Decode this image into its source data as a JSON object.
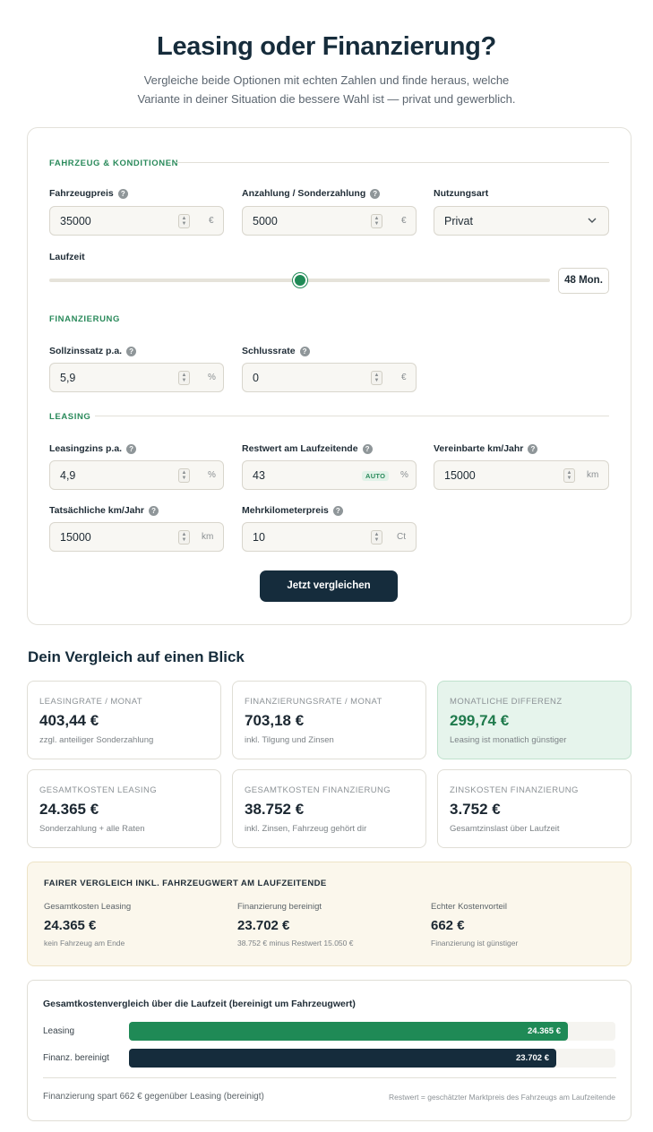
{
  "header": {
    "title": "Leasing oder Finanzierung?",
    "subtitle": "Vergleiche beide Optionen mit echten Zahlen und finde heraus, welche Variante in deiner Situation die bessere Wahl ist — privat und gewerblich."
  },
  "form": {
    "section_vehicle": "Fahrzeug & Konditionen",
    "section_financing": "Finanzierung",
    "section_leasing": "Leasing",
    "vehicle_price": {
      "label": "Fahrzeugpreis",
      "value": "35000",
      "unit": "€"
    },
    "down_payment": {
      "label": "Anzahlung / Sonderzahlung",
      "value": "5000",
      "unit": "€"
    },
    "usage": {
      "label": "Nutzungsart",
      "value": "Privat"
    },
    "term": {
      "label": "Laufzeit",
      "value": "48 Mon.",
      "slider_fraction": 0.5
    },
    "interest_rate": {
      "label": "Sollzinssatz p.a.",
      "value": "5,9",
      "unit": "%"
    },
    "final_rate": {
      "label": "Schlussrate",
      "value": "0",
      "unit": "€"
    },
    "leasing_rate": {
      "label": "Leasingzins p.a.",
      "value": "4,9",
      "unit": "%"
    },
    "residual": {
      "label": "Restwert am Laufzeitende",
      "value": "43",
      "badge": "AUTO",
      "unit": "%"
    },
    "agreed_km": {
      "label": "Vereinbarte km/Jahr",
      "value": "15000",
      "unit": "km"
    },
    "actual_km": {
      "label": "Tatsächliche km/Jahr",
      "value": "15000",
      "unit": "km"
    },
    "extra_km_price": {
      "label": "Mehrkilometerpreis",
      "value": "10",
      "unit": "Ct"
    },
    "help_glyph": "?",
    "submit": "Jetzt vergleichen"
  },
  "results": {
    "heading": "Dein Vergleich auf einen Blick",
    "cards": [
      {
        "key": "Leasingrate / Monat",
        "value": "403,44 €",
        "sub": "zzgl. anteiliger Sonderzahlung"
      },
      {
        "key": "Finanzierungsrate / Monat",
        "value": "703,18 €",
        "sub": "inkl. Tilgung und Zinsen"
      },
      {
        "key": "Monatliche Differenz",
        "value": "299,74 €",
        "sub": "Leasing ist monatlich günstiger"
      },
      {
        "key": "Gesamtkosten Leasing",
        "value": "24.365 €",
        "sub": "Sonderzahlung + alle Raten"
      },
      {
        "key": "Gesamtkosten Finanzierung",
        "value": "38.752 €",
        "sub": "inkl. Zinsen, Fahrzeug gehört dir"
      },
      {
        "key": "Zinskosten Finanzierung",
        "value": "3.752 €",
        "sub": "Gesamtzinslast über Laufzeit"
      }
    ],
    "fair": {
      "title": "Fairer Vergleich inkl. Fahrzeugwert am Laufzeitende",
      "cols": [
        {
          "key": "Gesamtkosten Leasing",
          "value": "24.365 €",
          "sub": "kein Fahrzeug am Ende"
        },
        {
          "key": "Finanzierung bereinigt",
          "value": "23.702 €",
          "sub": "38.752 € minus Restwert 15.050 €"
        },
        {
          "key": "Echter Kostenvorteil",
          "value": "662 €",
          "sub": "Finanzierung ist günstiger"
        }
      ]
    }
  },
  "chart_data": {
    "type": "bar",
    "title": "Gesamtkostenvergleich über die Laufzeit (bereinigt um Fahrzeugwert)",
    "categories": [
      "Leasing",
      "Finanz. bereinigt"
    ],
    "values": [
      24365,
      23702
    ],
    "value_labels": [
      "24.365 €",
      "23.702 €"
    ],
    "colors": [
      "#1f8a56",
      "#152c3c"
    ],
    "footer_left": "Finanzierung spart 662 € gegenüber Leasing (bereinigt)",
    "footer_right": "Restwert = geschätzter Marktpreis des Fahrzeugs am Laufzeitende"
  }
}
